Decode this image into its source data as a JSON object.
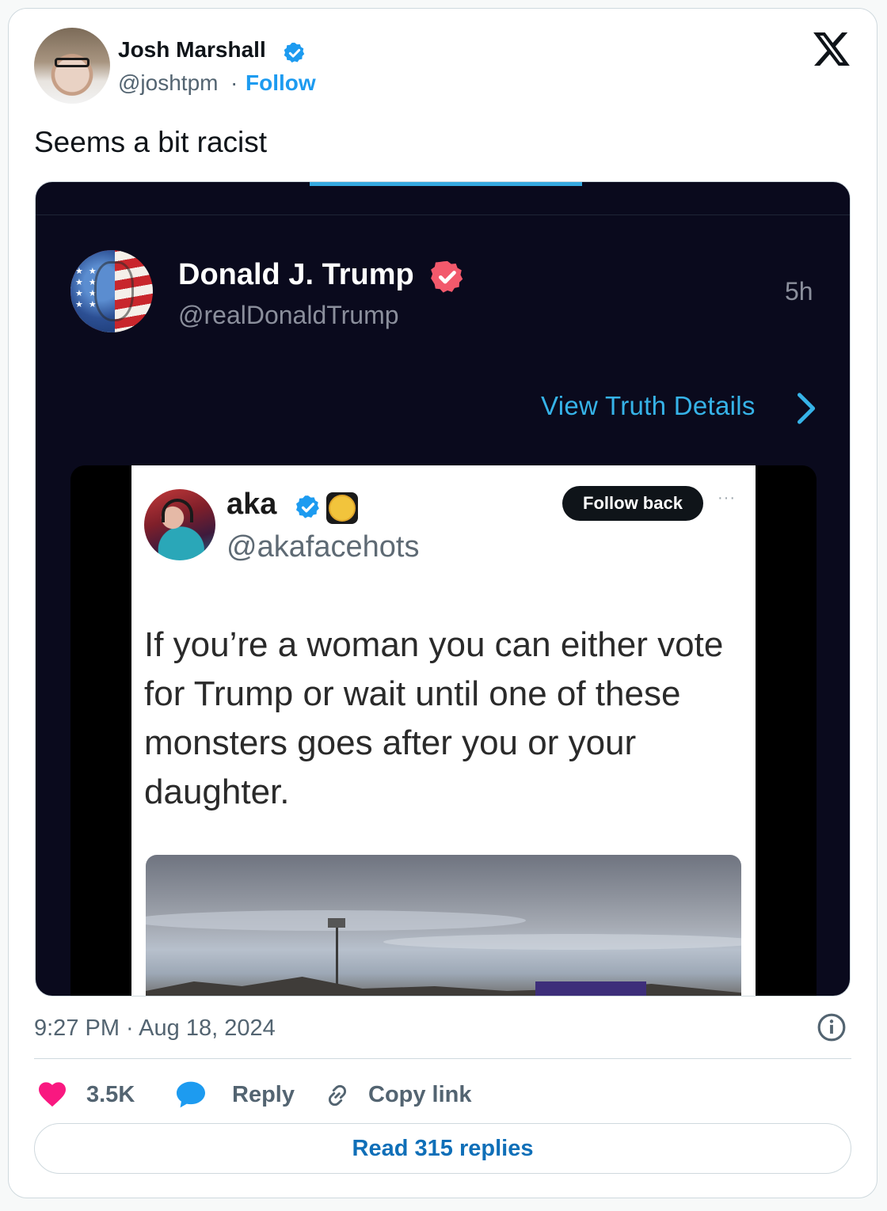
{
  "tweet": {
    "author": {
      "name": "Josh Marshall",
      "handle": "@joshtpm",
      "separator": "·",
      "follow_label": "Follow"
    },
    "text": "Seems a bit racist",
    "timestamp": "9:27 PM · Aug 18, 2024",
    "actions": {
      "likes": "3.5K",
      "reply_label": "Reply",
      "copy_label": "Copy link"
    },
    "read_replies_label": "Read 315 replies"
  },
  "truth_post": {
    "name": "Donald J. Trump",
    "handle": "@realDonaldTrump",
    "time": "5h",
    "view_details_label": "View Truth Details",
    "embedded": {
      "name": "aka",
      "handle": "@akafacehots",
      "follow_back_label": "Follow back",
      "more_label": "···",
      "text": "If you’re a woman you can either vote for Trump or wait until one of these monsters goes after you or your daughter."
    }
  },
  "colors": {
    "accent_blue": "#1d9bf0",
    "truth_link": "#36b3e8",
    "like_pink": "#f91880",
    "truth_badge": "#f2596c",
    "media_bg": "#0a0a1d"
  },
  "icons": {
    "verified": "verified-badge-icon",
    "x_logo": "x-logo-icon",
    "like": "heart-icon",
    "reply": "speech-bubble-icon",
    "copy": "link-icon",
    "info": "info-icon",
    "chevron": "chevron-right-icon"
  }
}
